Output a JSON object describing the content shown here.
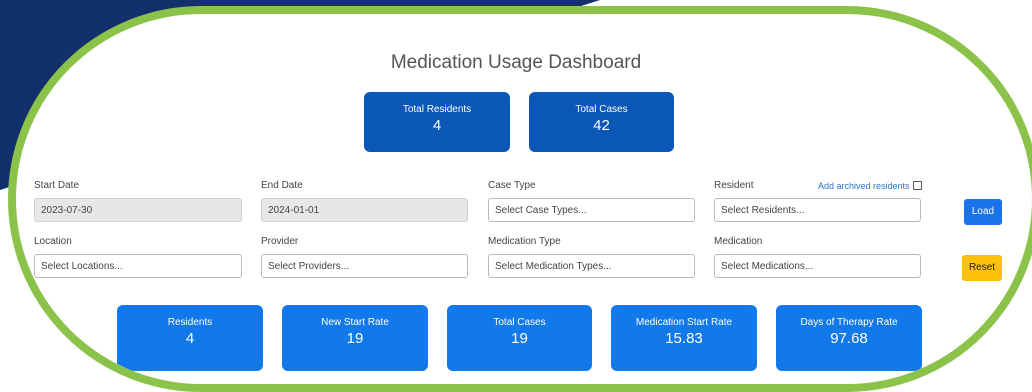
{
  "dashboard": {
    "title": "Medication Usage Dashboard",
    "top_kpis": [
      {
        "label": "Total Residents",
        "value": "4"
      },
      {
        "label": "Total Cases",
        "value": "42"
      }
    ],
    "filters": {
      "start_date": {
        "label": "Start Date",
        "value": "2023-07-30"
      },
      "end_date": {
        "label": "End Date",
        "value": "2024-01-01"
      },
      "case_type": {
        "label": "Case Type",
        "placeholder": "Select Case Types..."
      },
      "resident": {
        "label": "Resident",
        "placeholder": "Select Residents...",
        "archived_label": "Add archived residents"
      },
      "location": {
        "label": "Location",
        "placeholder": "Select Locations..."
      },
      "provider": {
        "label": "Provider",
        "placeholder": "Select Providers..."
      },
      "medication_type": {
        "label": "Medication Type",
        "placeholder": "Select Medication Types..."
      },
      "medication": {
        "label": "Medication",
        "placeholder": "Select Medications..."
      }
    },
    "buttons": {
      "load": "Load",
      "reset": "Reset"
    },
    "bottom_kpis": [
      {
        "label": "Residents",
        "value": "4"
      },
      {
        "label": "New Start Rate",
        "value": "19"
      },
      {
        "label": "Total Cases",
        "value": "19"
      },
      {
        "label": "Medication Start Rate",
        "value": "15.83"
      },
      {
        "label": "Days of Therapy Rate",
        "value": "97.68"
      }
    ]
  },
  "colors": {
    "navy": "#12306b",
    "frame_green": "#8bc34a",
    "kpi_dark": "#0a57b7",
    "kpi_light": "#1279ea",
    "load_blue": "#1a73e8",
    "reset_yellow": "#ffc107"
  }
}
